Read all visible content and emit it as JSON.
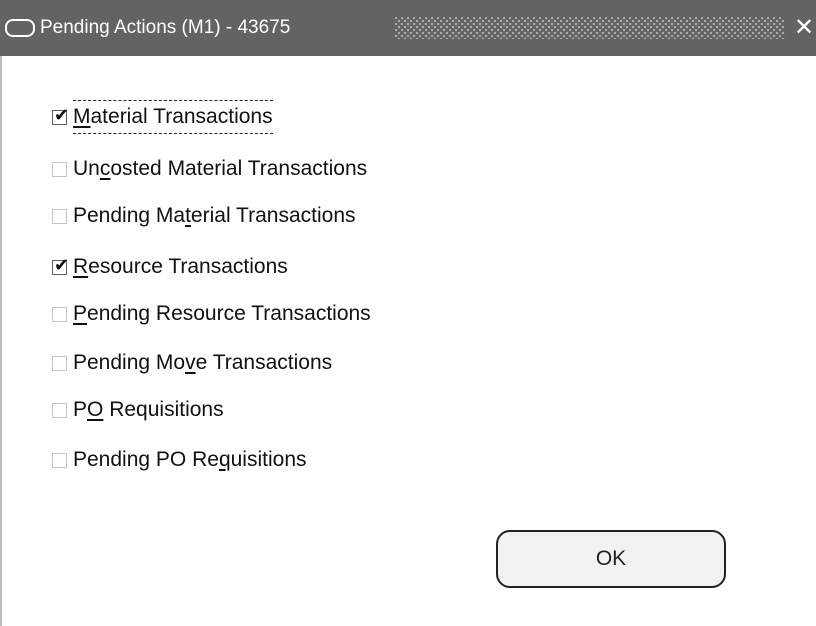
{
  "window": {
    "title": "Pending Actions (M1) - 43675",
    "close_glyph": "✕"
  },
  "options": [
    {
      "prefix": "",
      "accel": "M",
      "suffix": "aterial Transactions",
      "checked": true,
      "check_glyph": "✔"
    },
    {
      "prefix": "Un",
      "accel": "c",
      "suffix": "osted Material Transactions",
      "checked": false
    },
    {
      "prefix": "Pending Ma",
      "accel": "t",
      "suffix": "erial Transactions",
      "checked": false
    },
    {
      "prefix": "",
      "accel": "R",
      "suffix": "esource Transactions",
      "checked": true,
      "check_glyph": "✔"
    },
    {
      "prefix": "",
      "accel": "P",
      "suffix": "ending Resource Transactions",
      "checked": false
    },
    {
      "prefix": "Pending Mo",
      "accel": "v",
      "suffix": "e Transactions",
      "checked": false
    },
    {
      "prefix": "P",
      "accel": "O",
      "suffix": " Requisitions",
      "checked": false
    },
    {
      "prefix": "Pending PO Re",
      "accel": "q",
      "suffix": "uisitions",
      "checked": false
    }
  ],
  "buttons": {
    "ok_label": "OK"
  }
}
